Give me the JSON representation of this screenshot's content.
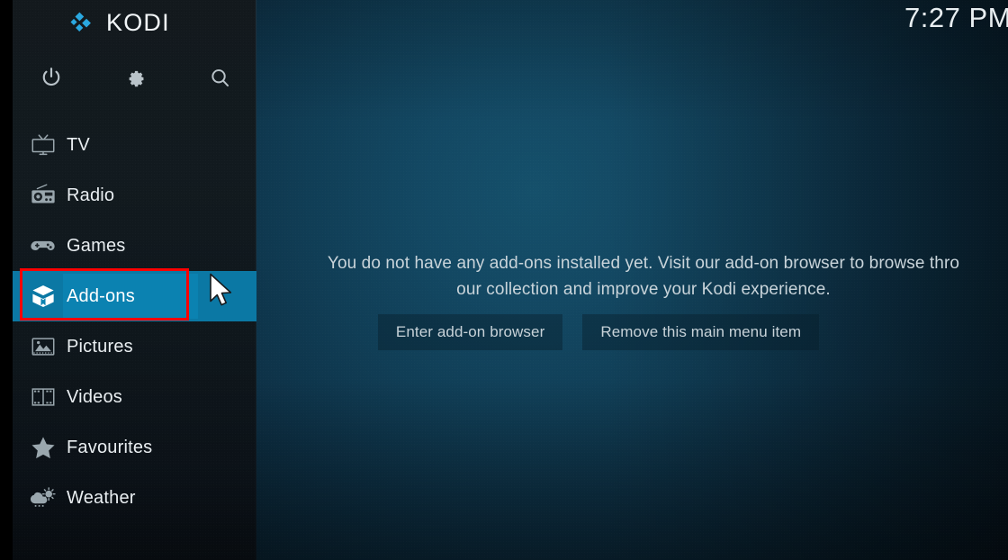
{
  "app": {
    "name": "KODI",
    "logo_mark_color": "#2aa8e0",
    "logo_text_color": "#f2f6f8"
  },
  "clock": {
    "time": "7:27 PM"
  },
  "top_icons": [
    {
      "name": "power-icon",
      "label": "Power"
    },
    {
      "name": "settings-icon",
      "label": "Settings"
    },
    {
      "name": "search-icon",
      "label": "Search"
    }
  ],
  "sidebar": {
    "selected_index": 3,
    "highlight_color": "#0b78a4",
    "items": [
      {
        "label": "TV",
        "icon": "tv-icon"
      },
      {
        "label": "Radio",
        "icon": "radio-icon"
      },
      {
        "label": "Games",
        "icon": "gamepad-icon"
      },
      {
        "label": "Add-ons",
        "icon": "addons-box-icon"
      },
      {
        "label": "Pictures",
        "icon": "pictures-icon"
      },
      {
        "label": "Videos",
        "icon": "film-strip-icon"
      },
      {
        "label": "Favourites",
        "icon": "star-icon"
      },
      {
        "label": "Weather",
        "icon": "weather-cloud-sun-icon"
      }
    ]
  },
  "annotation": {
    "color": "#fe0000",
    "target": "Add-ons"
  },
  "main": {
    "message_line1": "You do not have any add-ons installed yet. Visit our add-on browser to browse thro",
    "message_line2": "our collection and improve your Kodi experience.",
    "buttons": [
      {
        "label": "Enter add-on browser"
      },
      {
        "label": "Remove this main menu item"
      }
    ]
  }
}
